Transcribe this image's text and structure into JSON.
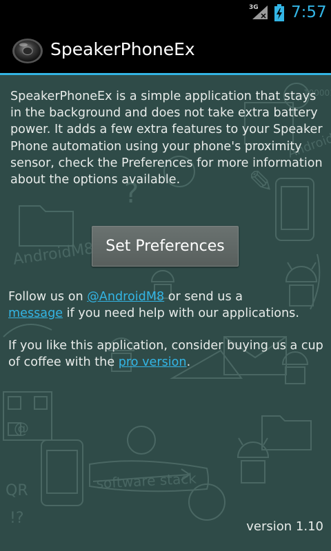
{
  "status_bar": {
    "network_type": "3G",
    "time": "7:57",
    "accent_color": "#33b5e5"
  },
  "action_bar": {
    "title": "SpeakerPhoneEx",
    "icon": "speaker-icon"
  },
  "content": {
    "intro": "SpeakerPhoneEx is a simple application that stays in the background and does not take extra battery power. It adds a few extra features to your Speaker Phone automation using your phone's proximity sensor, check the Preferences for more information about the options available.",
    "set_preferences_label": "Set Preferences",
    "follow": {
      "prefix": "Follow us on ",
      "twitter_link": "@AndroidM8",
      "middle": " or send us a",
      "message_link": "message",
      "suffix": " if you need help with our applications."
    },
    "coffee": {
      "prefix": "If you like this application, consider buying us a cup of coffee with the ",
      "pro_link": "pro version",
      "suffix": "."
    },
    "version": "version 1.10"
  },
  "background_doodles": [
    "AndroidM8",
    "software stack",
    "Android",
    "QR"
  ]
}
